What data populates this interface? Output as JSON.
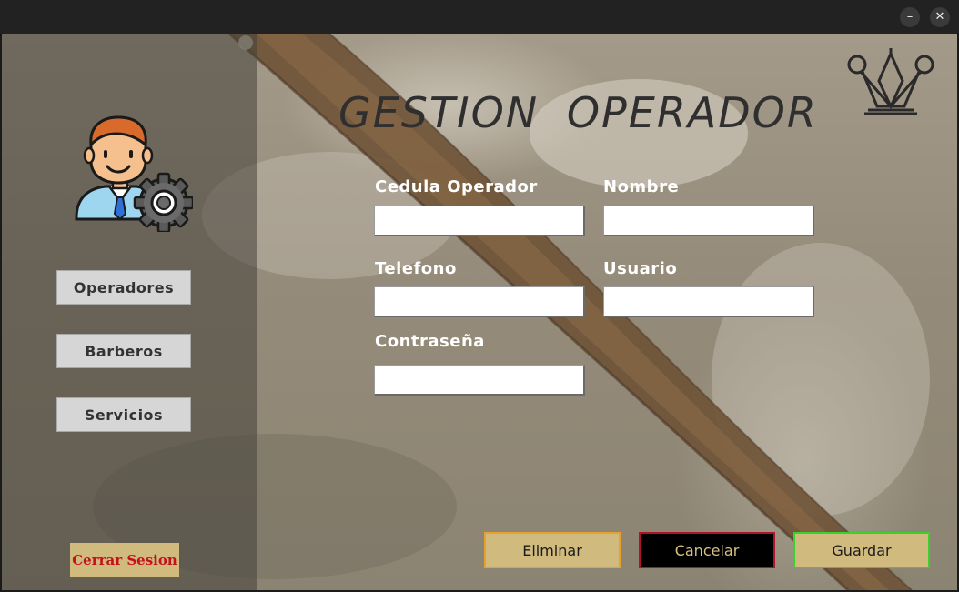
{
  "window": {
    "minimize_glyph": "–",
    "close_glyph": "✕"
  },
  "title": "GESTION  OPERADOR",
  "sidebar": {
    "items": [
      {
        "label": "Operadores"
      },
      {
        "label": "Barberos"
      },
      {
        "label": "Servicios"
      }
    ],
    "logout_label": "Cerrar Sesion"
  },
  "form": {
    "cedula_label": "Cedula Operador",
    "cedula_value": "",
    "nombre_label": "Nombre",
    "nombre_value": "",
    "telefono_label": "Telefono",
    "telefono_value": "",
    "usuario_label": "Usuario",
    "usuario_value": "",
    "contrasena_label": "Contraseña",
    "contrasena_value": ""
  },
  "actions": {
    "delete_label": "Eliminar",
    "cancel_label": "Cancelar",
    "save_label": "Guardar"
  },
  "icons": {
    "avatar": "operator-settings-icon",
    "logo": "crown-logo-icon"
  },
  "colors": {
    "button_gold": "#d1ba7e",
    "delete_border": "#e6a22a",
    "cancel_border": "#b01325",
    "save_border": "#3ad12a",
    "logout_text": "#c4121b"
  }
}
